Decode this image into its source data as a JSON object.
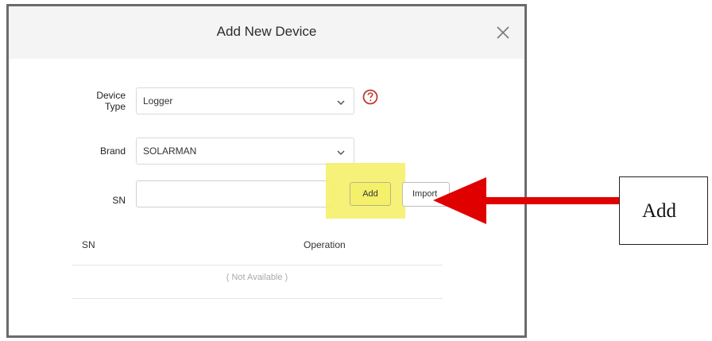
{
  "dialog": {
    "title": "Add New Device",
    "close_icon": "close-icon",
    "device_type": {
      "label": "Device\nType",
      "value": "Logger",
      "help_icon": "question-circle-icon",
      "help_color": "#c0392b"
    },
    "brand": {
      "label": "Brand",
      "value": "SOLARMAN"
    },
    "sn": {
      "label": "SN",
      "value": "",
      "placeholder": ""
    },
    "buttons": {
      "add": "Add",
      "import": "Import"
    },
    "table": {
      "columns": [
        "SN",
        "Operation"
      ],
      "empty_text": "( Not Available )"
    }
  },
  "annotation": {
    "callout_text": "Add",
    "highlight_color": "#f5f06a",
    "arrow_color": "#e00000"
  }
}
